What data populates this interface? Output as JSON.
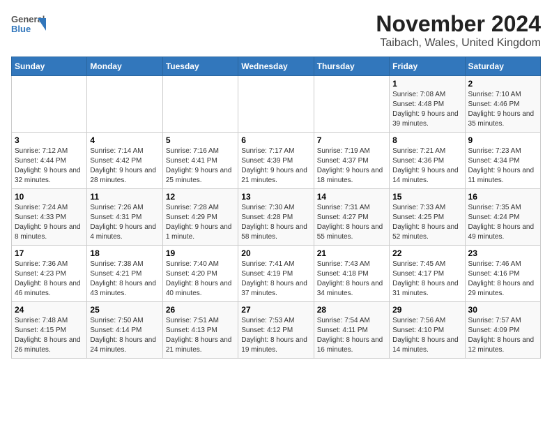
{
  "header": {
    "logo_line1": "General",
    "logo_line2": "Blue",
    "title": "November 2024",
    "subtitle": "Taibach, Wales, United Kingdom"
  },
  "days_of_week": [
    "Sunday",
    "Monday",
    "Tuesday",
    "Wednesday",
    "Thursday",
    "Friday",
    "Saturday"
  ],
  "weeks": [
    [
      {
        "day": "",
        "info": ""
      },
      {
        "day": "",
        "info": ""
      },
      {
        "day": "",
        "info": ""
      },
      {
        "day": "",
        "info": ""
      },
      {
        "day": "",
        "info": ""
      },
      {
        "day": "1",
        "info": "Sunrise: 7:08 AM\nSunset: 4:48 PM\nDaylight: 9 hours and 39 minutes."
      },
      {
        "day": "2",
        "info": "Sunrise: 7:10 AM\nSunset: 4:46 PM\nDaylight: 9 hours and 35 minutes."
      }
    ],
    [
      {
        "day": "3",
        "info": "Sunrise: 7:12 AM\nSunset: 4:44 PM\nDaylight: 9 hours and 32 minutes."
      },
      {
        "day": "4",
        "info": "Sunrise: 7:14 AM\nSunset: 4:42 PM\nDaylight: 9 hours and 28 minutes."
      },
      {
        "day": "5",
        "info": "Sunrise: 7:16 AM\nSunset: 4:41 PM\nDaylight: 9 hours and 25 minutes."
      },
      {
        "day": "6",
        "info": "Sunrise: 7:17 AM\nSunset: 4:39 PM\nDaylight: 9 hours and 21 minutes."
      },
      {
        "day": "7",
        "info": "Sunrise: 7:19 AM\nSunset: 4:37 PM\nDaylight: 9 hours and 18 minutes."
      },
      {
        "day": "8",
        "info": "Sunrise: 7:21 AM\nSunset: 4:36 PM\nDaylight: 9 hours and 14 minutes."
      },
      {
        "day": "9",
        "info": "Sunrise: 7:23 AM\nSunset: 4:34 PM\nDaylight: 9 hours and 11 minutes."
      }
    ],
    [
      {
        "day": "10",
        "info": "Sunrise: 7:24 AM\nSunset: 4:33 PM\nDaylight: 9 hours and 8 minutes."
      },
      {
        "day": "11",
        "info": "Sunrise: 7:26 AM\nSunset: 4:31 PM\nDaylight: 9 hours and 4 minutes."
      },
      {
        "day": "12",
        "info": "Sunrise: 7:28 AM\nSunset: 4:29 PM\nDaylight: 9 hours and 1 minute."
      },
      {
        "day": "13",
        "info": "Sunrise: 7:30 AM\nSunset: 4:28 PM\nDaylight: 8 hours and 58 minutes."
      },
      {
        "day": "14",
        "info": "Sunrise: 7:31 AM\nSunset: 4:27 PM\nDaylight: 8 hours and 55 minutes."
      },
      {
        "day": "15",
        "info": "Sunrise: 7:33 AM\nSunset: 4:25 PM\nDaylight: 8 hours and 52 minutes."
      },
      {
        "day": "16",
        "info": "Sunrise: 7:35 AM\nSunset: 4:24 PM\nDaylight: 8 hours and 49 minutes."
      }
    ],
    [
      {
        "day": "17",
        "info": "Sunrise: 7:36 AM\nSunset: 4:23 PM\nDaylight: 8 hours and 46 minutes."
      },
      {
        "day": "18",
        "info": "Sunrise: 7:38 AM\nSunset: 4:21 PM\nDaylight: 8 hours and 43 minutes."
      },
      {
        "day": "19",
        "info": "Sunrise: 7:40 AM\nSunset: 4:20 PM\nDaylight: 8 hours and 40 minutes."
      },
      {
        "day": "20",
        "info": "Sunrise: 7:41 AM\nSunset: 4:19 PM\nDaylight: 8 hours and 37 minutes."
      },
      {
        "day": "21",
        "info": "Sunrise: 7:43 AM\nSunset: 4:18 PM\nDaylight: 8 hours and 34 minutes."
      },
      {
        "day": "22",
        "info": "Sunrise: 7:45 AM\nSunset: 4:17 PM\nDaylight: 8 hours and 31 minutes."
      },
      {
        "day": "23",
        "info": "Sunrise: 7:46 AM\nSunset: 4:16 PM\nDaylight: 8 hours and 29 minutes."
      }
    ],
    [
      {
        "day": "24",
        "info": "Sunrise: 7:48 AM\nSunset: 4:15 PM\nDaylight: 8 hours and 26 minutes."
      },
      {
        "day": "25",
        "info": "Sunrise: 7:50 AM\nSunset: 4:14 PM\nDaylight: 8 hours and 24 minutes."
      },
      {
        "day": "26",
        "info": "Sunrise: 7:51 AM\nSunset: 4:13 PM\nDaylight: 8 hours and 21 minutes."
      },
      {
        "day": "27",
        "info": "Sunrise: 7:53 AM\nSunset: 4:12 PM\nDaylight: 8 hours and 19 minutes."
      },
      {
        "day": "28",
        "info": "Sunrise: 7:54 AM\nSunset: 4:11 PM\nDaylight: 8 hours and 16 minutes."
      },
      {
        "day": "29",
        "info": "Sunrise: 7:56 AM\nSunset: 4:10 PM\nDaylight: 8 hours and 14 minutes."
      },
      {
        "day": "30",
        "info": "Sunrise: 7:57 AM\nSunset: 4:09 PM\nDaylight: 8 hours and 12 minutes."
      }
    ]
  ]
}
